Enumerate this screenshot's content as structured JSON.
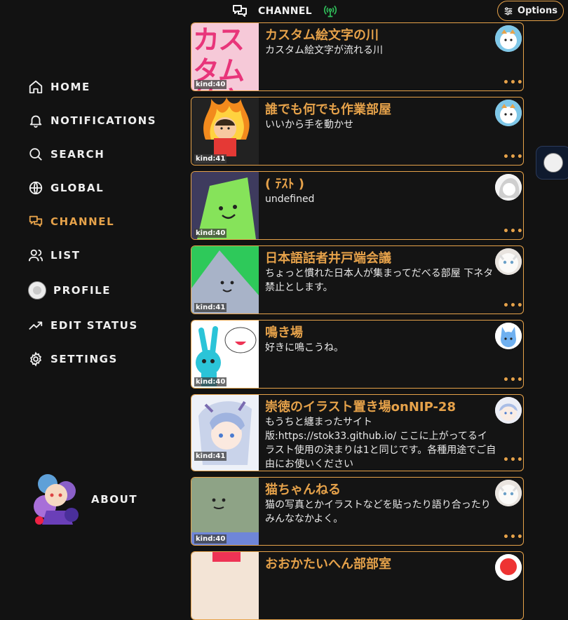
{
  "header": {
    "title": "CHANNEL",
    "options_label": "Options"
  },
  "sidebar": {
    "items": [
      {
        "label": "HOME",
        "icon": "home-icon"
      },
      {
        "label": "NOTIFICATIONS",
        "icon": "bell-icon"
      },
      {
        "label": "SEARCH",
        "icon": "search-icon"
      },
      {
        "label": "GLOBAL",
        "icon": "globe-icon"
      },
      {
        "label": "CHANNEL",
        "icon": "channel-icon",
        "active": true
      },
      {
        "label": "LIST",
        "icon": "users-icon"
      },
      {
        "label": "PROFILE",
        "icon": "profile-avatar"
      },
      {
        "label": "EDIT STATUS",
        "icon": "trend-icon"
      },
      {
        "label": "SETTINGS",
        "icon": "gear-icon"
      }
    ],
    "about_label": "ABOUT"
  },
  "channels": [
    {
      "title": "カスタム絵文字の川",
      "desc": "カスタム絵文字が流れる川",
      "kind": "kind:40",
      "thumb_text": "カスタム絵文字"
    },
    {
      "title": "誰でも何でも作業部屋",
      "desc": "いいから手を動かせ",
      "kind": "kind:41"
    },
    {
      "title": "( ﾃｽﾄ )",
      "desc": "undefined",
      "kind": "kind:40"
    },
    {
      "title": "日本語話者井戸端会議",
      "desc": "ちょっと慣れた日本人が集まってだべる部屋 下ネタ禁止とします。",
      "kind": "kind:41"
    },
    {
      "title": "鳴き場",
      "desc": "好きに鳴こうね。",
      "kind": "kind:40"
    },
    {
      "title": "崇徳のイラスト置き場onNIP-28",
      "desc": "もうちと纏まったサイト版:https://stok33.github.io/ ここに上がってるイラスト使用の決まりは1と同じです。各種用途でご自由にお使いください",
      "kind": "kind:41"
    },
    {
      "title": "猫ちゃんねる",
      "desc": "猫の写真とかイラストなどを貼ったり語り合ったり みんななかよく。",
      "kind": "kind:40"
    },
    {
      "title": "おおかたいへん部部室",
      "desc": "",
      "kind": ""
    }
  ],
  "more_glyph": "•••",
  "colors": {
    "accent": "#e6a24a",
    "background": "#121212",
    "text": "#efefef"
  }
}
